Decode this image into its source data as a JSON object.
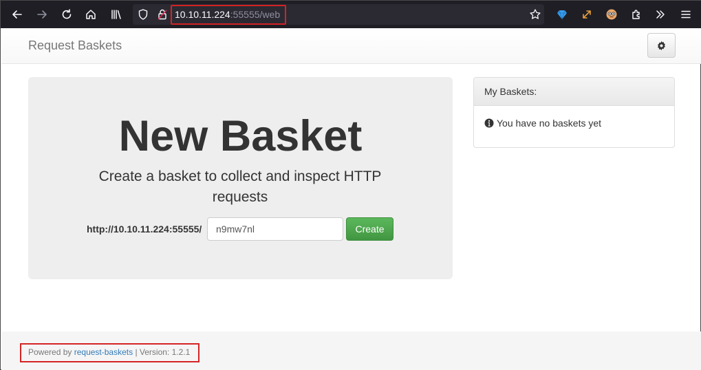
{
  "browser": {
    "url_host": "10.10.11.224",
    "url_rest": ":55555/web",
    "icons": [
      "back-icon",
      "forward-icon",
      "reload-icon",
      "home-icon",
      "library-icon",
      "shield-icon",
      "lock-icon",
      "bookmark-star-icon",
      "extension-gem-icon",
      "resize-icon",
      "avatar-icon",
      "extensions-icon",
      "overflow-icon",
      "menu-icon"
    ]
  },
  "navbar": {
    "brand": "Request Baskets",
    "settings_icon": "gear-icon"
  },
  "jumbotron": {
    "title": "New Basket",
    "subtitle": "Create a basket to collect and inspect HTTP requests",
    "url_prefix": "http://10.10.11.224:55555/",
    "basket_name_value": "n9mw7nl",
    "create_label": "Create"
  },
  "panel": {
    "heading": "My Baskets:",
    "empty_message": "You have no baskets yet",
    "empty_icon": "info-circle-icon"
  },
  "footer": {
    "powered_by": "Powered by",
    "link_text": "request-baskets",
    "version_text": "| Version: 1.2.1"
  },
  "colors": {
    "toolbar_bg": "#1f1e25",
    "highlight_red": "#d42424",
    "create_green": "#5cb85c",
    "link_blue": "#337ab7"
  }
}
